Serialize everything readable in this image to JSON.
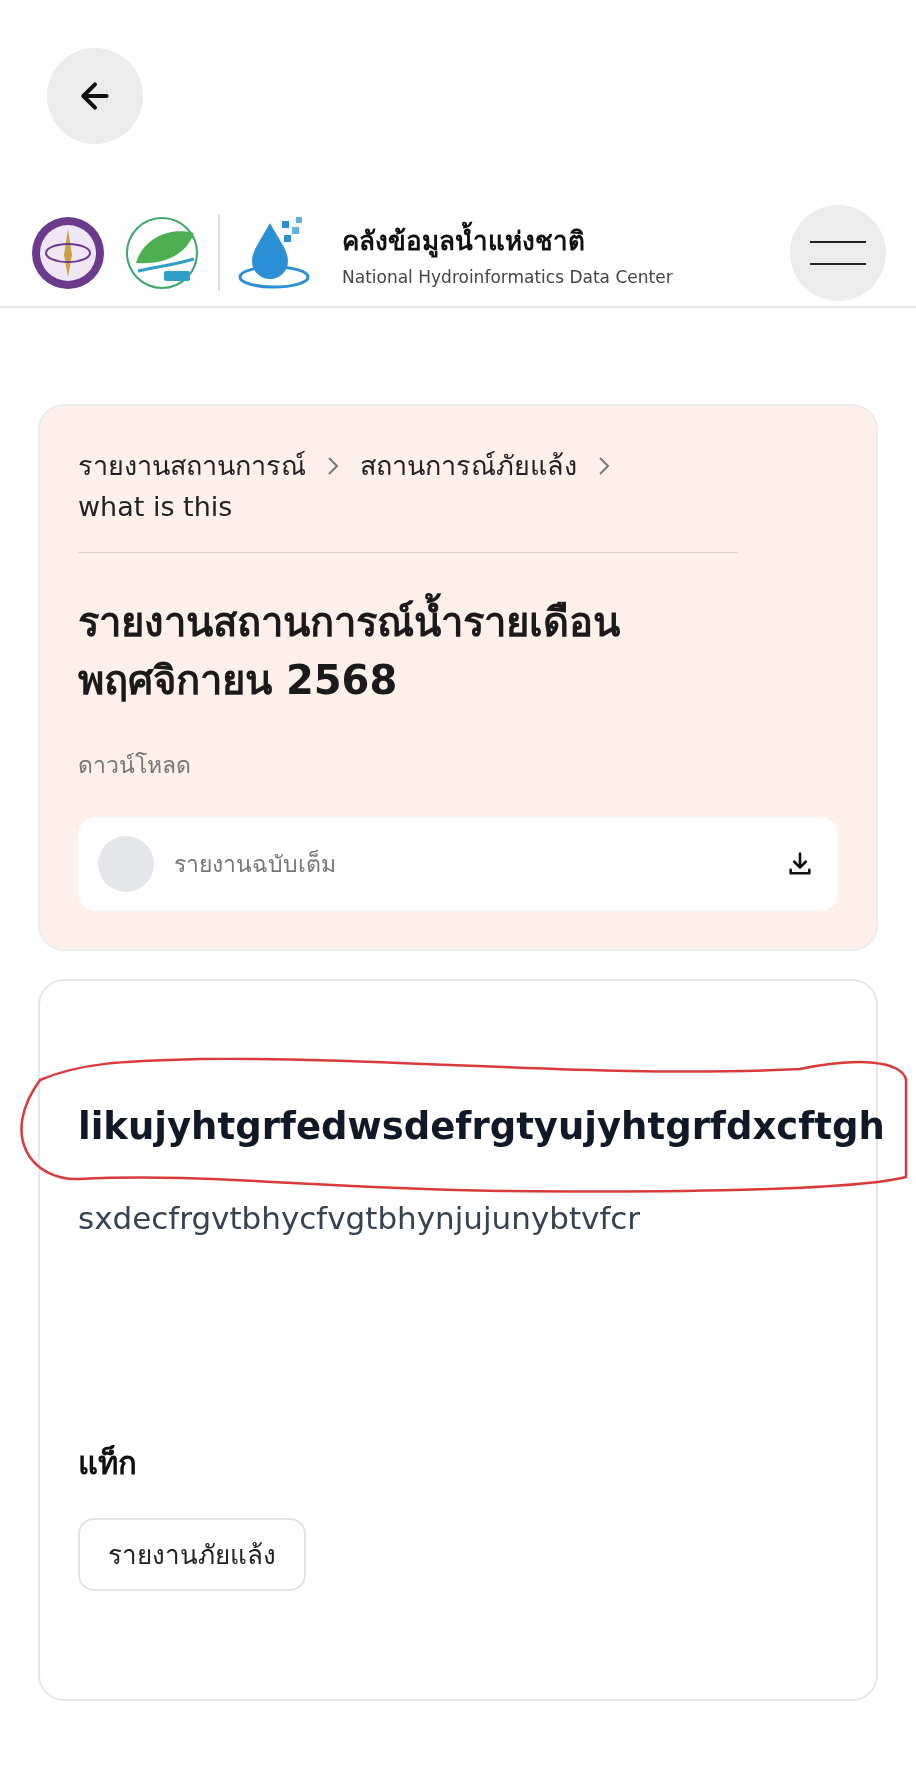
{
  "header": {
    "title": "คลังข้อมูลน้ำแห่งชาติ",
    "subtitle": "National Hydroinformatics Data Center"
  },
  "breadcrumbs": [
    "รายงานสถานการณ์",
    "สถานการณ์ภัยแล้ง",
    "what is this"
  ],
  "report": {
    "title": "รายงานสถานการณ์น้ำรายเดือน พฤศจิกายน 2568",
    "download_label": "ดาวน์โหลด",
    "files": [
      {
        "name": "รายงานฉบับเต็ม"
      }
    ]
  },
  "detail": {
    "heading": "likujyhtgrfedwsdefrgtyujyhtgrfdxcftgh",
    "description": "sxdecfrgvtbhycfvgtbhynjujunybtvfcr",
    "tags_label": "แท็ก",
    "tags": [
      "รายงานภัยแล้ง"
    ]
  }
}
